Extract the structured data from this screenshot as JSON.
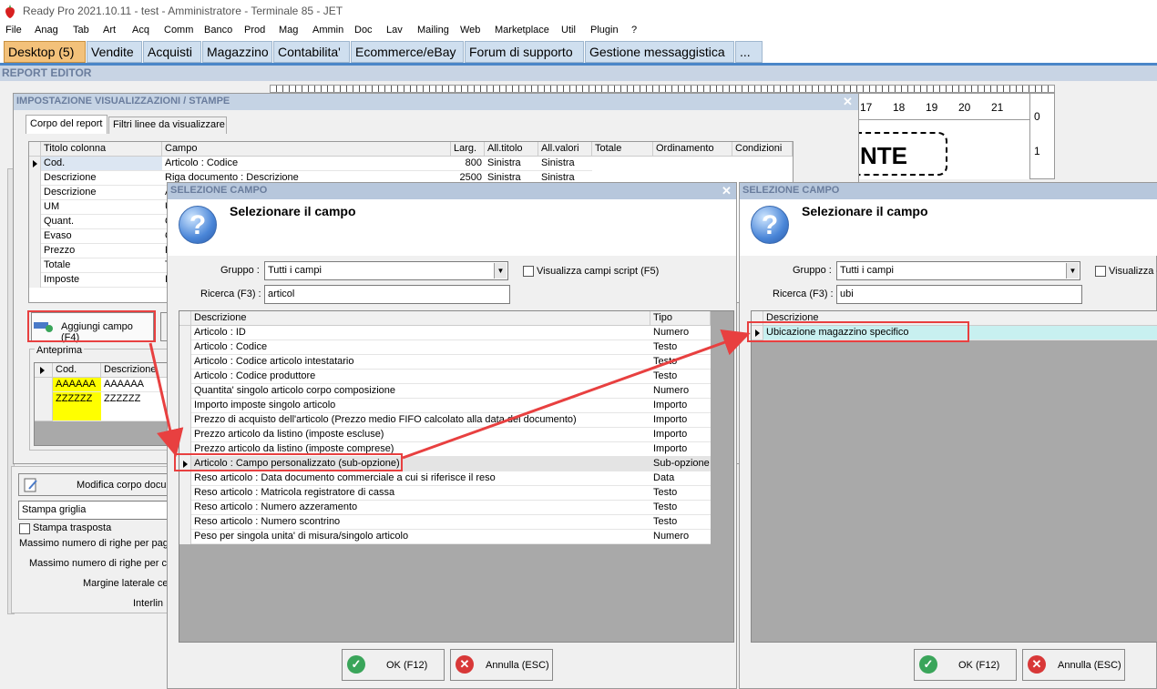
{
  "window": {
    "title": "Ready Pro 2021.10.11 - test - Amministratore - Terminale 85 - JET"
  },
  "menu": [
    "File",
    "Anag",
    "Tab",
    "Art",
    "Acq",
    "Comm",
    "Banco",
    "Prod",
    "Mag",
    "Ammin",
    "Doc",
    "Lav",
    "Mailing",
    "Web",
    "Marketplace",
    "Util",
    "Plugin",
    "?"
  ],
  "tabs": [
    "Desktop (5)",
    "Vendite",
    "Acquisti",
    "Magazzino",
    "Contabilita'",
    "Ecommerce/eBay",
    "Forum di supporto",
    "Gestione messaggistica",
    "..."
  ],
  "report_editor": {
    "title": "REPORT EDITOR",
    "ruler_ticks": [
      "17",
      "18",
      "19",
      "20",
      "21"
    ],
    "vruler_ticks": [
      "0",
      "1"
    ],
    "preview_text": "NTE"
  },
  "settings_dialog": {
    "title": "IMPOSTAZIONE VISUALIZZAZIONI / STAMPE",
    "tabs": [
      "Corpo del report",
      "Filtri linee da visualizzare"
    ],
    "columns": [
      "Titolo colonna",
      "Campo",
      "Larg.",
      "All.titolo",
      "All.valori",
      "Totale",
      "Ordinamento",
      "Condizioni"
    ],
    "rows": [
      {
        "titolo": "Cod.",
        "campo": "Articolo : Codice",
        "larg": "800",
        "all_titolo": "Sinistra",
        "all_valori": "Sinistra"
      },
      {
        "titolo": "Descrizione",
        "campo": "Riga documento : Descrizione",
        "larg": "2500",
        "all_titolo": "Sinistra",
        "all_valori": "Sinistra"
      },
      {
        "titolo": "Descrizione",
        "campo": "A",
        "larg": "",
        "all_titolo": "",
        "all_valori": ""
      },
      {
        "titolo": "UM",
        "campo": "U",
        "larg": "",
        "all_titolo": "",
        "all_valori": ""
      },
      {
        "titolo": "Quant.",
        "campo": "Q",
        "larg": "",
        "all_titolo": "",
        "all_valori": ""
      },
      {
        "titolo": "Evaso",
        "campo": "Q",
        "larg": "",
        "all_titolo": "",
        "all_valori": ""
      },
      {
        "titolo": "Prezzo",
        "campo": "P",
        "larg": "",
        "all_titolo": "",
        "all_valori": ""
      },
      {
        "titolo": "Totale",
        "campo": "T",
        "larg": "",
        "all_titolo": "",
        "all_valori": ""
      },
      {
        "titolo": "Imposte",
        "campo": "I",
        "larg": "",
        "all_titolo": "",
        "all_valori": ""
      }
    ],
    "add_field_button": "Aggiungi campo (F4)",
    "preview_label": "Anteprima",
    "preview_columns": [
      "Cod.",
      "Descrizione"
    ],
    "preview_rows": [
      [
        "AAAAAA",
        "AAAAAA"
      ],
      [
        "ZZZZZZ",
        "ZZZZZZ"
      ]
    ],
    "edit_body_button": "Modifica corpo docum",
    "print_mode": "Stampa griglia",
    "transposed_label": "Stampa trasposta",
    "max_rows_page": "Massimo numero di righe per pagin",
    "max_rows_cell": "Massimo numero di righe per cel",
    "side_margin": "Margine laterale cel",
    "line_spacing": "Interlin"
  },
  "select_dialog_1": {
    "title": "SELEZIONE CAMPO",
    "heading": "Selezionare il campo",
    "group_label": "Gruppo :",
    "group_value": "Tutti i campi",
    "script_checkbox": "Visualizza campi script (F5)",
    "search_label": "Ricerca (F3) :",
    "search_value": "articol",
    "columns": [
      "Descrizione",
      "Tipo"
    ],
    "rows": [
      {
        "desc": "Articolo : ID",
        "tipo": "Numero"
      },
      {
        "desc": "Articolo : Codice",
        "tipo": "Testo"
      },
      {
        "desc": "Articolo : Codice articolo intestatario",
        "tipo": "Testo"
      },
      {
        "desc": "Articolo : Codice produttore",
        "tipo": "Testo"
      },
      {
        "desc": "Quantita' singolo articolo corpo composizione",
        "tipo": "Numero"
      },
      {
        "desc": "Importo imposte singolo articolo",
        "tipo": "Importo"
      },
      {
        "desc": "Prezzo di acquisto dell'articolo (Prezzo medio FIFO calcolato alla data del documento)",
        "tipo": "Importo"
      },
      {
        "desc": "Prezzo articolo da listino (imposte escluse)",
        "tipo": "Importo"
      },
      {
        "desc": "Prezzo articolo da listino (imposte comprese)",
        "tipo": "Importo"
      },
      {
        "desc": "Articolo : Campo personalizzato (sub-opzione)",
        "tipo": "Sub-opzione"
      },
      {
        "desc": "Reso articolo : Data documento commerciale a cui si riferisce il reso",
        "tipo": "Data"
      },
      {
        "desc": "Reso articolo : Matricola registratore di cassa",
        "tipo": "Testo"
      },
      {
        "desc": "Reso articolo : Numero azzeramento",
        "tipo": "Testo"
      },
      {
        "desc": "Reso articolo : Numero scontrino",
        "tipo": "Testo"
      },
      {
        "desc": "Peso per singola unita' di misura/singolo articolo",
        "tipo": "Numero"
      }
    ],
    "ok_button": "OK (F12)",
    "cancel_button": "Annulla (ESC)"
  },
  "select_dialog_2": {
    "title": "SELEZIONE CAMPO",
    "heading": "Selezionare il campo",
    "group_label": "Gruppo :",
    "group_value": "Tutti i campi",
    "script_checkbox": "Visualizza c",
    "search_label": "Ricerca (F3) :",
    "search_value": "ubi",
    "columns": [
      "Descrizione"
    ],
    "rows": [
      {
        "desc": "Ubicazione magazzino specifico"
      }
    ],
    "ok_button": "OK (F12)",
    "cancel_button": "Annulla (ESC)"
  },
  "colors": {
    "highlight_box": "#e84040",
    "yellow_cell": "#ffff00",
    "selected_row": "#c8f0f0",
    "active_tab": "#f3c17a"
  }
}
